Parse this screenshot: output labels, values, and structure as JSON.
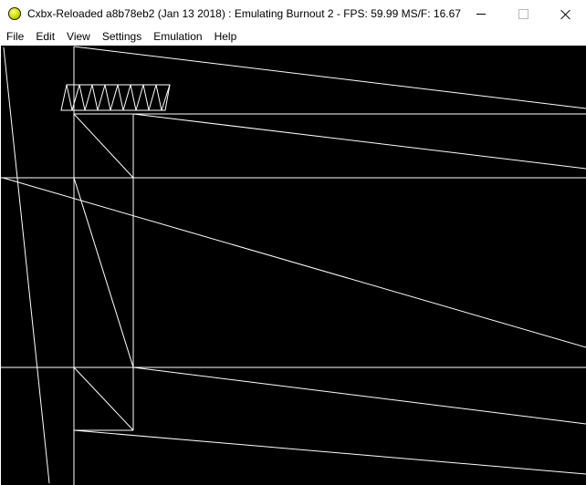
{
  "window": {
    "title": "Cxbx-Reloaded a8b78eb2 (Jan 13 2018) : Emulating Burnout 2 - FPS: 59.99  MS/F: 16.67",
    "icon": "cxbx-app-icon"
  },
  "menu": {
    "items": [
      {
        "label": "File"
      },
      {
        "label": "Edit"
      },
      {
        "label": "View"
      },
      {
        "label": "Settings"
      },
      {
        "label": "Emulation"
      },
      {
        "label": "Help"
      }
    ]
  },
  "viewport": {
    "background": "#000000",
    "line_color": "#ffffff"
  }
}
